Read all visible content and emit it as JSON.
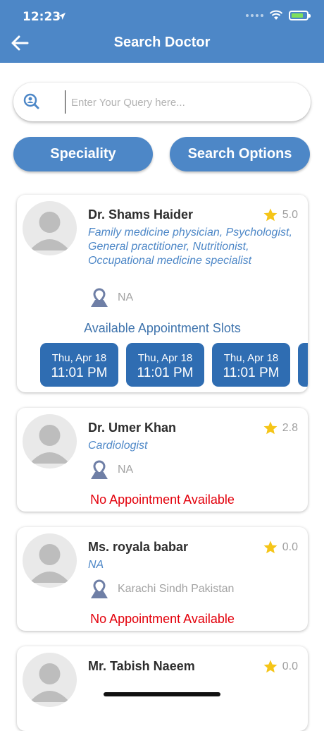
{
  "status_bar": {
    "time": "12:23"
  },
  "header": {
    "title": "Search Doctor"
  },
  "search": {
    "placeholder": "Enter Your Query here..."
  },
  "filters": {
    "speciality_label": "Speciality",
    "search_options_label": "Search Options"
  },
  "doctors": [
    {
      "name": "Dr. Shams Haider",
      "rating": "5.0",
      "specialty": "Family medicine physician, Psychologist, General practitioner, Nutritionist, Occupational medicine specialist",
      "location": "NA",
      "slots_title": "Available Appointment Slots",
      "slots": [
        {
          "day": "Thu, Apr 18",
          "time": "11:01 PM"
        },
        {
          "day": "Thu, Apr 18",
          "time": "11:01 PM"
        },
        {
          "day": "Thu, Apr 18",
          "time": "11:01 PM"
        }
      ]
    },
    {
      "name": "Dr. Umer Khan",
      "rating": "2.8",
      "specialty": "Cardiologist",
      "location": "NA",
      "no_appointment": "No Appointment Available"
    },
    {
      "name": "Ms. royala babar",
      "rating": "0.0",
      "specialty": "NA",
      "location": "Karachi Sindh Pakistan",
      "no_appointment": "No Appointment Available"
    },
    {
      "name": "Mr. Tabish Naeem",
      "rating": "0.0"
    }
  ],
  "colors": {
    "primary": "#4d87c7",
    "slot": "#2f6db2",
    "star": "#f5c518",
    "error": "#e3000b"
  }
}
